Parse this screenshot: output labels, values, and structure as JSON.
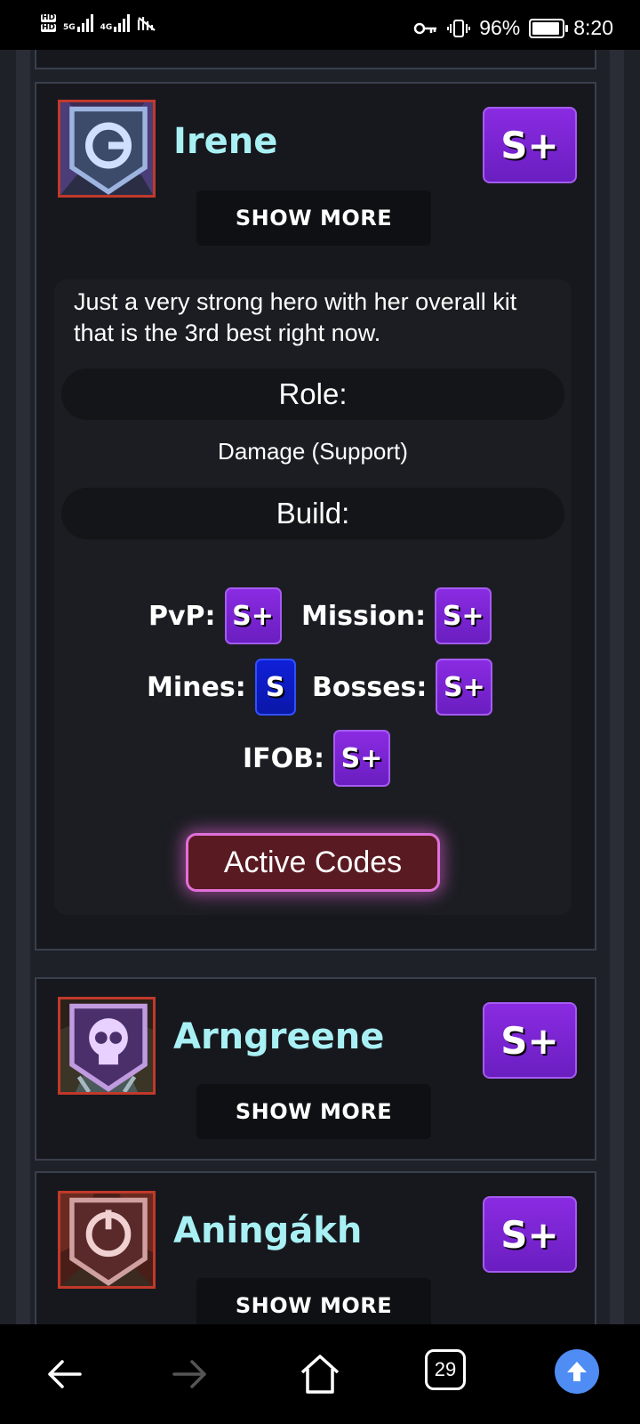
{
  "status_bar": {
    "network_labels": [
      "5G",
      "4G"
    ],
    "battery": "96%",
    "time": "8:20"
  },
  "heroes": [
    {
      "name": "Irene",
      "tier": "S+",
      "show_more": "SHOW MORE",
      "expanded": true,
      "description": "Just a very strong hero with her overall kit that is the 3rd best right now.",
      "role_label": "Role:",
      "role_value": "Damage (Support)",
      "build_label": "Build:",
      "ratings": [
        {
          "label": "PvP:",
          "tier": "S+"
        },
        {
          "label": "Mission:",
          "tier": "S+"
        },
        {
          "label": "Mines:",
          "tier": "S"
        },
        {
          "label": "Bosses:",
          "tier": "S+"
        },
        {
          "label": "IFOB:",
          "tier": "S+"
        }
      ],
      "codes_button": "Active Codes"
    },
    {
      "name": "Arngreene",
      "tier": "S+",
      "show_more": "SHOW MORE",
      "expanded": false
    },
    {
      "name": "Aningákh",
      "tier": "S+",
      "show_more": "SHOW MORE",
      "expanded": false
    }
  ],
  "nav_bar": {
    "tab_count": "29",
    "colors": {
      "scroll_top_button": "#4f8df5"
    }
  },
  "colors": {
    "hero_name": "#a8f0f4",
    "tier_splus": "#7b24d6",
    "tier_s": "#1020d8",
    "codes_glow": "#e070d8"
  }
}
